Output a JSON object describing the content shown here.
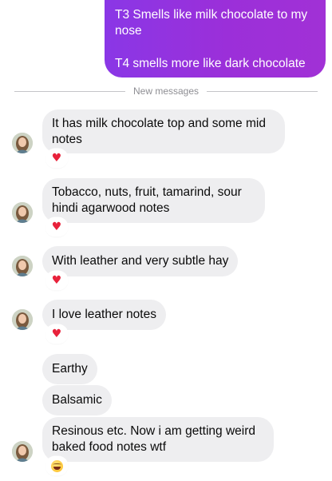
{
  "sent_message": {
    "line1": "T3 Smells like milk chocolate to my nose",
    "line2": "T4 smells more like dark chocolate"
  },
  "divider": {
    "label": "New messages"
  },
  "received_messages": [
    {
      "text": "It has milk chocolate top and some mid notes",
      "reaction": "heart"
    },
    {
      "text": "Tobacco, nuts, fruit, tamarind, sour hindi agarwood notes",
      "reaction": "heart"
    },
    {
      "text": "With leather and very subtle hay",
      "reaction": "heart"
    },
    {
      "text": "I love leather notes",
      "reaction": "heart"
    },
    {
      "text": "Earthy"
    },
    {
      "text": "Balsamic"
    },
    {
      "text": "Resinous etc. Now i am getting weird baked food notes wtf",
      "reaction": "laughing-face"
    }
  ],
  "colors": {
    "sent_bubble": "#9333ea",
    "received_bubble": "#eeeef0",
    "heart": "#e8223b"
  }
}
